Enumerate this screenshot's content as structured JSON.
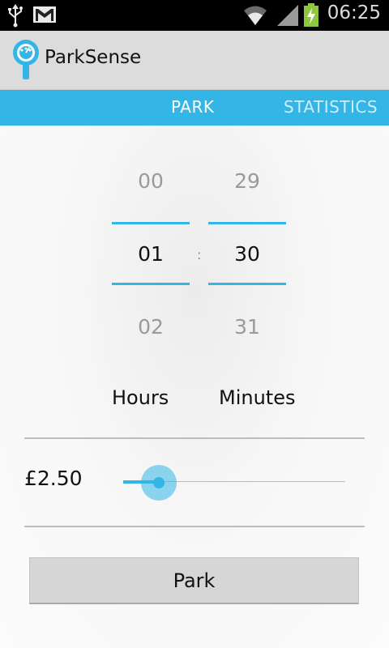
{
  "status_bar": {
    "time": "06:25",
    "icons": [
      "usb-icon",
      "gmail-icon",
      "wifi-icon",
      "signal-icon",
      "battery-charging-icon"
    ]
  },
  "action_bar": {
    "title": "ParkSense",
    "logo_icon": "parking-meter-icon"
  },
  "tabs": [
    {
      "label": "PARK",
      "selected": true
    },
    {
      "label": "STATISTICS",
      "selected": false
    }
  ],
  "time_picker": {
    "hours": {
      "prev": "00",
      "current": "01",
      "next": "02",
      "label": "Hours"
    },
    "minutes": {
      "prev": "29",
      "current": "30",
      "next": "31",
      "label": "Minutes"
    },
    "separator": ":"
  },
  "price": {
    "value": "£2.50",
    "slider_fraction": 0.16
  },
  "park_button": {
    "label": "Park"
  },
  "colors": {
    "accent": "#33b5e5",
    "action_bar": "#dcdcdc",
    "status_bar": "#000000"
  }
}
